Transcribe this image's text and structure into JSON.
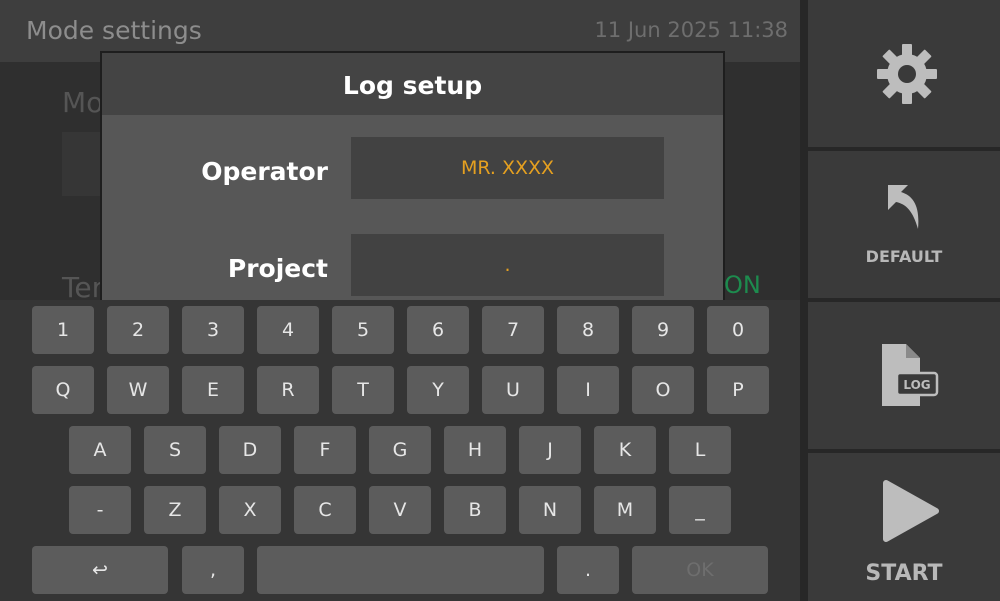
{
  "header": {
    "title": "Mode settings",
    "datetime": "11 Jun 2025 11:38"
  },
  "background": {
    "mode_label": "Mo",
    "temp_label": "Ter",
    "status_text": "ON"
  },
  "dialog": {
    "title": "Log setup",
    "operator_label": "Operator",
    "operator_value": "MR. XXXX",
    "project_label": "Project",
    "project_value": "."
  },
  "sidebar": {
    "default_label": "DEFAULT",
    "log_label": "LOG",
    "start_label": "START"
  },
  "keyboard": {
    "row1": [
      "1",
      "2",
      "3",
      "4",
      "5",
      "6",
      "7",
      "8",
      "9",
      "0"
    ],
    "row2": [
      "Q",
      "W",
      "E",
      "R",
      "T",
      "Y",
      "U",
      "I",
      "O",
      "P"
    ],
    "row3": [
      "A",
      "S",
      "D",
      "F",
      "G",
      "H",
      "J",
      "K",
      "L"
    ],
    "row4": [
      "-",
      "Z",
      "X",
      "C",
      "V",
      "B",
      "N",
      "M",
      "_"
    ],
    "backspace": "↩",
    "comma": ",",
    "space": "",
    "period": ".",
    "ok": "OK"
  },
  "colors": {
    "accent_value": "#e5a020",
    "status_on": "#1d8b4e"
  }
}
